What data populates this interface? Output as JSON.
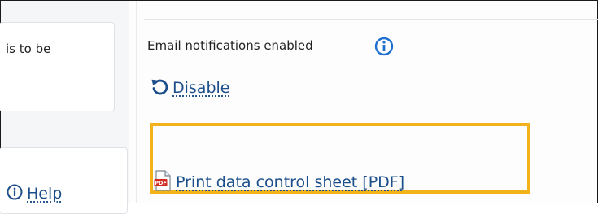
{
  "left_panel": {
    "truncated_text": "is to be",
    "help_label": "Help"
  },
  "email": {
    "label": "Email notifications enabled",
    "info_icon": "info-icon",
    "disable_label": "Disable",
    "disable_icon": "undo-icon"
  },
  "pdf": {
    "label": "Print data control sheet [PDF]",
    "icon": "pdf-icon"
  },
  "colors": {
    "link": "#1b4e8a",
    "highlight": "#f2b21a",
    "info_blue": "#1e6fd0"
  }
}
